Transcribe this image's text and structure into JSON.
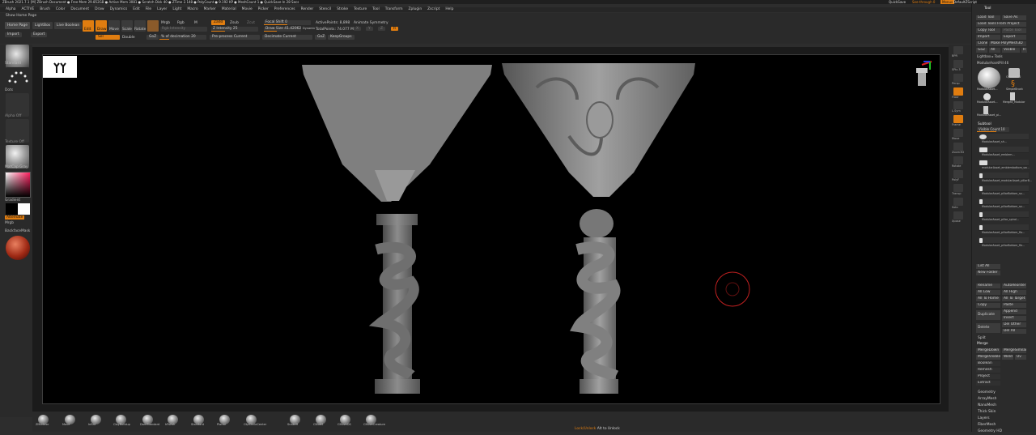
{
  "titlebar": {
    "title": "ZBrush 2021.7.1 [M]   ZBrush Document    ● Free Mem 29.852GB ● Active Mem 3081 ● Scratch Disk 40 ● ZTime 2.148 ● PolyCount ● 9.192 KP ● MeshCount 1 ● QuickSave In 28 Secs",
    "quicksave": "QuickSave",
    "see_through": "See-through  0",
    "menus_btn": "Menus",
    "script": "DefaultZScript"
  },
  "menubar": {
    "items": [
      "Alpha",
      "ACTIVE",
      "Brush",
      "Color",
      "Document",
      "Draw",
      "Dynamics",
      "Edit",
      "File",
      "Layer",
      "Light",
      "Macro",
      "Marker",
      "Material",
      "Movie",
      "Picker",
      "Preferences",
      "Render",
      "Stencil",
      "Stroke",
      "Texture",
      "Tool",
      "Transform",
      "Zplugin",
      "Zscript",
      "Help"
    ]
  },
  "topbar": {
    "show_home": "Show Home Page",
    "home_page": "Home Page",
    "lightbox": "LightBox",
    "live_boolean": "Live Boolean",
    "import": "Import",
    "export": "Export",
    "edit": "Edit",
    "draw": "Draw",
    "move": "Move",
    "scale": "Scale",
    "rotate": "Rotate",
    "mrgb": "Mrgb",
    "rgb": "Rgb",
    "m": "M",
    "rgb_intensity": "Rgb Intensity",
    "zadd": "Zadd",
    "zsub": "Zsub",
    "zcut": "Zcut",
    "z_intensity": "Z Intensity 25",
    "focal_shift": "Focal Shift 0",
    "draw_size": "Draw Size 41.42062",
    "dynamic": "Dynamic",
    "active_points": "ActivePoints: 8,898",
    "total_points": "TotalPoints: 74.077 Mil",
    "animate_symmetry": "Animate Symmetry",
    "pre_process": "Pre-process Current",
    "decimate": "Decimate Current",
    "of_decimation": "% of decimation 20",
    "sel": "Sel",
    "double": "Double",
    "gol": "GoZ",
    "keep_groups": "KeepGroups",
    "sym_x": "X",
    "sym_y": "Y",
    "sym_z": "Z",
    "sym_r": "R"
  },
  "leftshelf": {
    "brush": "Standard",
    "stroke": "Dots",
    "alpha": "Alpha Off",
    "texture": "Texture Off",
    "material": "MatCap Gray",
    "gradient": "Gradient",
    "switch_color": "SwitchColor",
    "alternate": "Alternate",
    "mrgb": "Mrgb",
    "backface": "BackfaceMask"
  },
  "rightshelf": {
    "labels": [
      "BPR",
      "SPix 3",
      "Persp",
      "Floor",
      "L.Sym",
      "Frame",
      "Move",
      "Zoom3D",
      "Rotate",
      "PolyF",
      "Transp",
      "Solo",
      "Xpose"
    ]
  },
  "toolpanel": {
    "title": "Tool",
    "load_tool": "Load Tool",
    "save_as": "Save As",
    "load_from_project": "Load Tools From Project",
    "copy_tool": "Copy Tool",
    "paste_tool": "Paste Tool",
    "import": "Import",
    "export": "Export",
    "clone": "Clone",
    "make_polymesh": "Make PolyMesh3D",
    "goz": "GoZ",
    "all": "All",
    "visible": "Visible",
    "r": "R",
    "lightbox_tools": "Lightbox ▸ Tools",
    "current_tool": "ModularAssetPill  46",
    "tool_thumbs": [
      "ModularAsset...",
      "Cylinder3D",
      "SimpleBrush",
      "ModularAsset...",
      "Merged_Modular",
      "ModularAsset_pi..."
    ],
    "subtool_title": "Subtool",
    "visible_count": "Visible Count 10",
    "subtools": [
      "ModularAsset_sh...",
      "ModularAsset_emblem...",
      "modularAsset_emblembottom_sw...",
      "ModularAsset_modularAsset_pillarB...",
      "ModularAsset_pillarBottom_so...",
      "ModularAsset_pillarBottom_so...",
      "ModularAsset_pillar_spiral...",
      "ModularAsset_pillarBottom_flo...",
      "ModularAsset_pillarBottom_fle..."
    ],
    "list_all": "List All",
    "new_folder": "New Folder",
    "rename": "Rename",
    "autoreorder": "AutoReorder",
    "all_low": "All Low",
    "all_high": "All High",
    "all_to_home": "All To Home",
    "all_to_target": "All To Target",
    "copy": "Copy",
    "paste": "Paste",
    "duplicate": "Duplicate",
    "append": "Append",
    "insert": "Insert",
    "delete": "Delete",
    "del_other": "Del Other",
    "del_all": "Del All",
    "split": "Split",
    "merge": "Merge",
    "merge_down": "MergeDown",
    "merge_similar": "MergeSimilar",
    "merge_visible": "MergeVisible",
    "weld": "Weld",
    "uv": "Uv",
    "boolean": "Boolean",
    "remesh": "Remesh",
    "project": "Project",
    "extract": "Extract",
    "sections": [
      "Geometry",
      "ArrayMesh",
      "NanoMesh",
      "Thick Skin",
      "Layers",
      "FiberMesh",
      "Geometry HD"
    ]
  },
  "bottomshelf": {
    "brushes": [
      "ZModeler",
      "Move",
      "Inflat",
      "ClayBuildup",
      "DamStandard",
      "hPolish",
      "Standard",
      "Planar",
      "ClipCircleCenter",
      "SnakeH",
      "CBlobS",
      "CMoveDS",
      "CMoveCreature"
    ],
    "status": "Lock/Unlock",
    "status_hint": "Alt to Unlock"
  },
  "canvas": {
    "logo_text": "YY"
  },
  "colors": {
    "accent": "#e07d10",
    "background": "#2d2d2d",
    "canvas": "#000000"
  }
}
